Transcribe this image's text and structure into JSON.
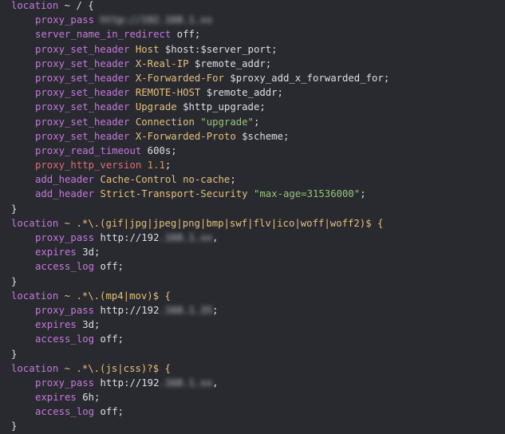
{
  "blocks": [
    {
      "location_kw": "location",
      "location_rest": " ~ / {",
      "lines": [
        {
          "d": "proxy_pass",
          "a": " ",
          "blur": "http://192.168.1.xx",
          "tail": ""
        },
        {
          "d": "server_name_in_redirect",
          "a": " off;"
        },
        {
          "d": "proxy_set_header",
          "h": " Host",
          "a": " $host:$server_port;"
        },
        {
          "d": "proxy_set_header",
          "h": " X-Real-IP",
          "a": " $remote_addr;"
        },
        {
          "d": "proxy_set_header",
          "h": " X-Forwarded-For",
          "a": " $proxy_add_x_forwarded_for;"
        },
        {
          "d": "proxy_set_header",
          "h": " REMOTE-HOST",
          "a": " $remote_addr;"
        },
        {
          "d": "proxy_set_header",
          "h": " Upgrade",
          "a": " $http_upgrade;"
        },
        {
          "d": "proxy_set_header",
          "h": " Connection",
          "s": " \"upgrade\"",
          "a": ";"
        },
        {
          "d": "proxy_set_header",
          "h": " X-Forwarded-Proto",
          "a": " $scheme;"
        },
        {
          "d": "proxy_read_timeout",
          "a": " 600s;"
        },
        {
          "d": "proxy_http_version",
          "red": true,
          "n": " 1.1",
          "a": ";"
        },
        {
          "d": "add_header",
          "h": " Cache-Control no-cache",
          "a": ";"
        },
        {
          "d": "add_header",
          "h": " Strict-Transport-Security",
          "s": " \"max-age=31536000\"",
          "a": ";"
        }
      ],
      "close": "}"
    },
    {
      "location_kw": "location",
      "location_rest": " ~ .*\\.(gif|jpg|jpeg|png|bmp|swf|flv|ico|woff|woff2)$ {",
      "lines": [
        {
          "d": "proxy_pass",
          "a": " http://192",
          "blur": ".168.1.xx",
          "tail": ","
        },
        {
          "d": "expires",
          "a": " 3d;"
        },
        {
          "d": "access_log",
          "a": " off;"
        }
      ],
      "close": "}"
    },
    {
      "location_kw": "location",
      "location_rest": " ~ .*\\.(mp4|mov)$ {",
      "lines": [
        {
          "d": "proxy_pass",
          "a": " http://192",
          "blur": ".168.1.35",
          "tail": ";"
        },
        {
          "d": "expires",
          "a": " 3d;"
        },
        {
          "d": "access_log",
          "a": " off;"
        }
      ],
      "close": "}"
    },
    {
      "location_kw": "location",
      "location_rest": " ~ .*\\.(js|css)?$ {",
      "lines": [
        {
          "d": "proxy_pass",
          "a": " http://192",
          "blur": ".168.1.xx",
          "tail": ","
        },
        {
          "d": "expires",
          "a": " 6h;"
        },
        {
          "d": "access_log",
          "a": " off;"
        }
      ],
      "close": "}"
    }
  ]
}
